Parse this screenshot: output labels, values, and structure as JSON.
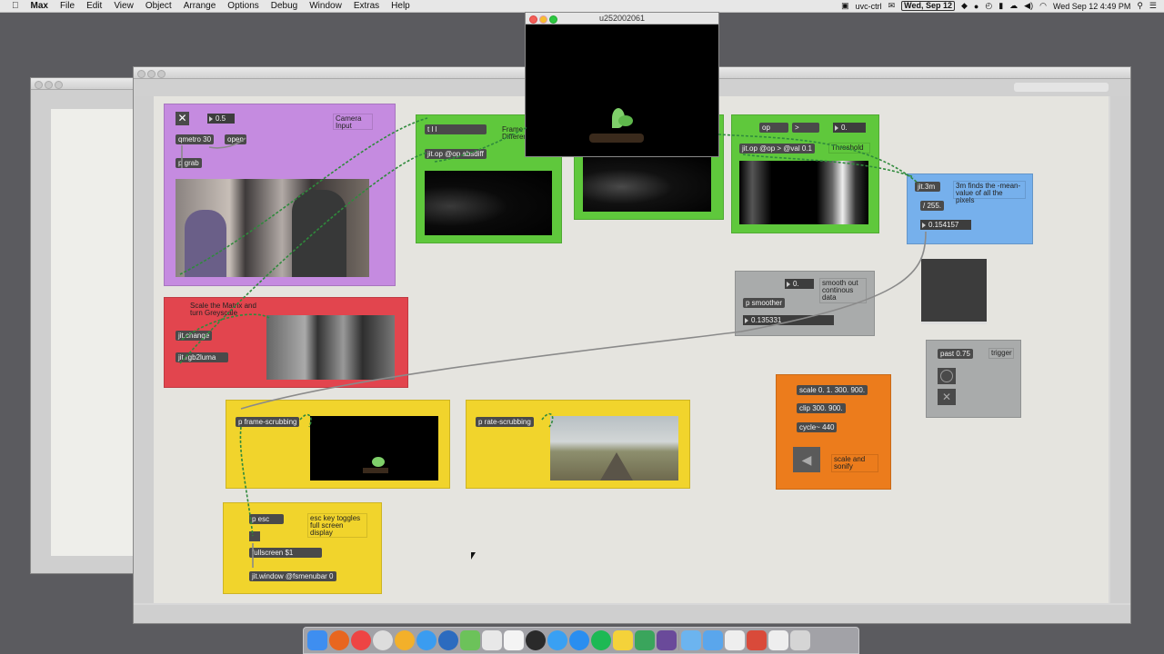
{
  "menubar": {
    "app": "Max",
    "items": [
      "File",
      "Edit",
      "View",
      "Object",
      "Arrange",
      "Options",
      "Debug",
      "Window",
      "Extras",
      "Help"
    ],
    "status_app": "uvc-ctrl",
    "date_badge": "Wed, Sep 12",
    "clock": "Wed Sep 12  4:49 PM"
  },
  "camera_window": {
    "title": "u252002061"
  },
  "camera_panel": {
    "toggle_glyph": "✕",
    "fps_value": "0.5",
    "qmetro": "qmetro 30",
    "open": "open",
    "grab": "p grab",
    "comment": "Camera Input"
  },
  "scale_panel": {
    "comment": "Scale the Matrix and turn Greyscale",
    "change": "jit.change",
    "rgb2luma": "jit.rgb2luma"
  },
  "frame_diff_panel": {
    "trigger": "t l l",
    "op": "jit.op @op absdiff",
    "comment": "Frame Difference"
  },
  "threshold_panel": {
    "op_label": "op",
    "op_select": ">",
    "val_number": "0.",
    "op": "jit.op @op > @val 0.1",
    "comment": "Threshold"
  },
  "mean_panel": {
    "obj": "jit.3m",
    "comment": "3m finds the -mean- value of all the pixels",
    "divide": "/ 255.",
    "value": "0.154157"
  },
  "smoother_panel": {
    "number": "0.",
    "comment": "smooth out continous data",
    "obj": "p smoother",
    "value": "0.135331"
  },
  "trigger_panel": {
    "past": "past 0.75",
    "comment": "trigger"
  },
  "sonify_panel": {
    "scale": "scale 0. 1. 300. 900.",
    "clip": "clip 300. 900.",
    "cycle": "cycle~ 440",
    "comment": "scale and sonify"
  },
  "frame_scrub_panel": {
    "obj": "p frame-scrubbing"
  },
  "rate_scrub_panel": {
    "obj": "p rate-scrubbing"
  },
  "esc_panel": {
    "esc": "p esc",
    "comment": "esc key toggles full screen display",
    "fullscreen": "fullscreen $1",
    "window": "jit.window @fsmenubar 0"
  },
  "colors": {
    "purple": "#c58be0",
    "red": "#e2454e",
    "green": "#5fc83c",
    "blue": "#76b0ec",
    "grey": "#a9abab",
    "orange": "#ec7c1c",
    "yellow": "#f1d42c"
  }
}
